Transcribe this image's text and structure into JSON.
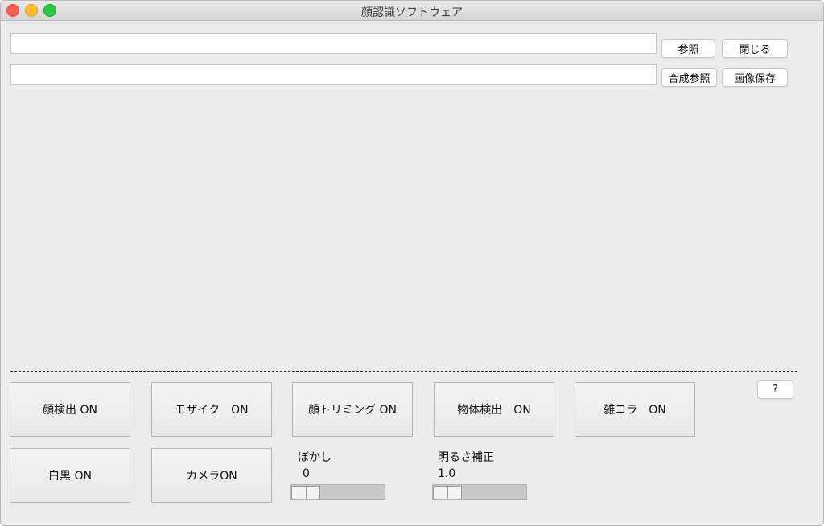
{
  "window": {
    "title": "顔認識ソフトウェア"
  },
  "inputs": {
    "top_value": "",
    "top_placeholder": "",
    "bottom_value": "",
    "bottom_placeholder": ""
  },
  "buttons": {
    "browse": "参照",
    "close": "閉じる",
    "composite_browse": "合成参照",
    "save_image": "画像保存",
    "help": "?",
    "face_detect": "顔検出 ON",
    "mosaic": "モザイク　ON",
    "face_trim": "顔トリミング ON",
    "object_detect": "物体検出　ON",
    "collage": "雑コラ　ON",
    "grayscale": "白黒 ON",
    "camera": "カメラON"
  },
  "sliders": {
    "blur": {
      "label": "ぼかし",
      "value": "0",
      "level": 0.0
    },
    "brightness": {
      "label": "明るさ補正",
      "value": "1.0",
      "level": 0.0
    }
  }
}
